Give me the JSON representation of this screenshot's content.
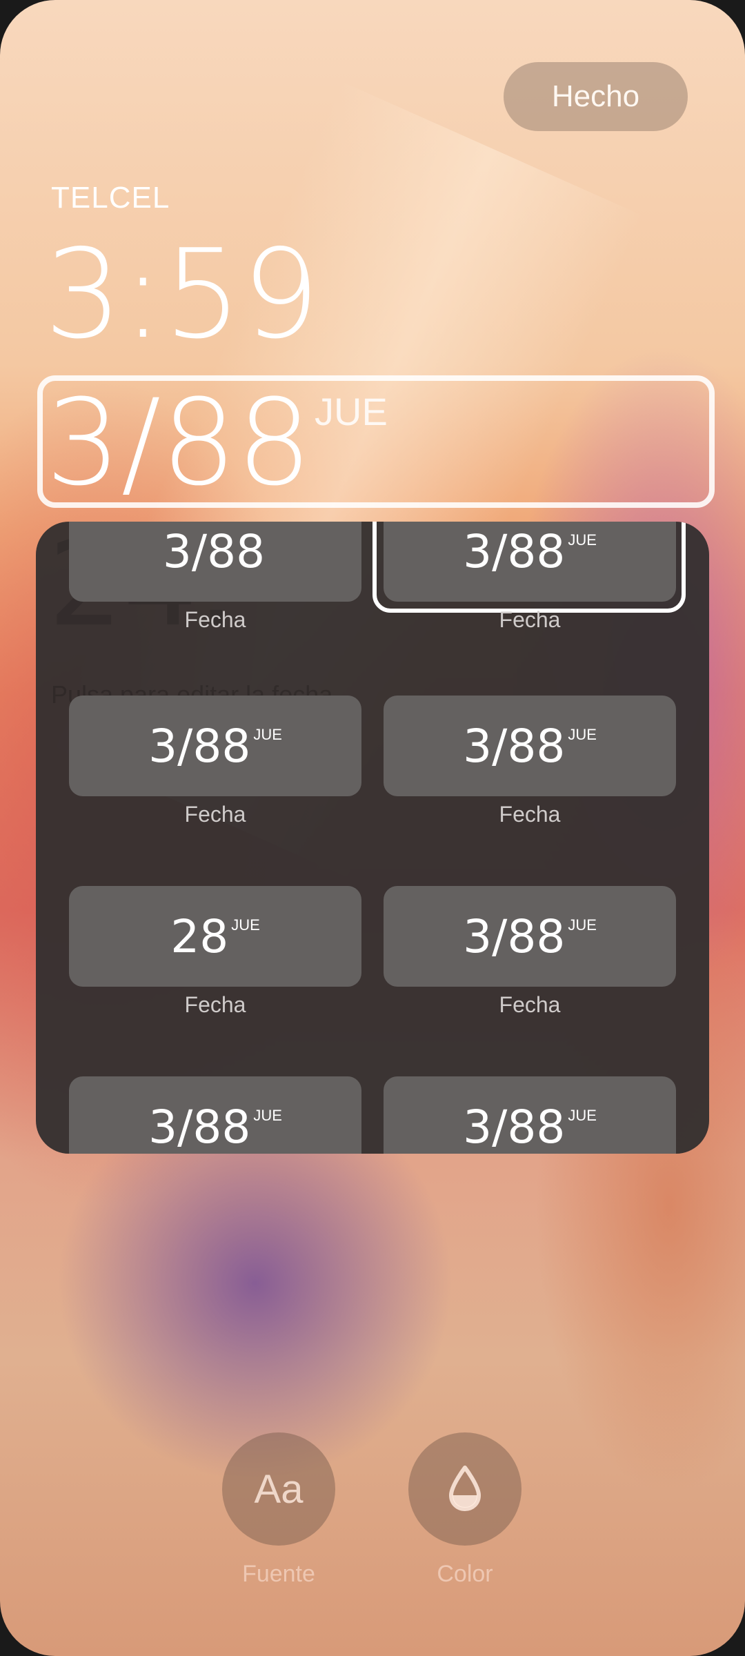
{
  "header": {
    "done_label": "Hecho"
  },
  "lockscreen": {
    "carrier": "TELCEL",
    "time": "3:59",
    "date": "3/88",
    "day": "JUE"
  },
  "picker": {
    "ghost_date": "24.",
    "ghost_hint": "Pulsa para editar la fecha",
    "items": [
      {
        "value": "3/88",
        "day": "",
        "label": "Fecha"
      },
      {
        "value": "3/88",
        "day": "JUE",
        "label": "Fecha",
        "selected": true
      },
      {
        "value": "3/88",
        "day": "JUE",
        "label": "Fecha"
      },
      {
        "value": "3/88",
        "day": "JUE",
        "label": "Fecha"
      },
      {
        "value": "28",
        "day": "JUE",
        "label": "Fecha"
      },
      {
        "value": "3/88",
        "day": "JUE",
        "label": "Fecha"
      },
      {
        "value": "3/88",
        "day": "JUE",
        "label": ""
      },
      {
        "value": "3/88",
        "day": "JUE",
        "label": ""
      }
    ]
  },
  "tools": {
    "font": {
      "icon_text": "Aa",
      "label": "Fuente",
      "icon": "font-icon"
    },
    "color": {
      "label": "Color",
      "icon": "droplet-icon"
    }
  },
  "colors": {
    "picker_bg": "#343030",
    "tile_bg": "#646160",
    "selection": "#ffffff"
  }
}
